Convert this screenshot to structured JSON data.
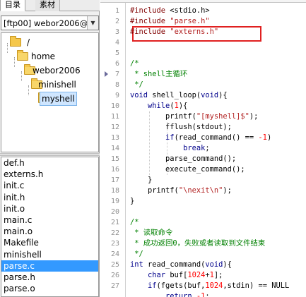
{
  "left_panel": {
    "tabs": [
      {
        "label": "目录"
      },
      {
        "label": "素材"
      }
    ],
    "project_select": {
      "value": "[ftp00] webor2006@"
    },
    "tree": [
      {
        "label": "/"
      },
      {
        "label": "home"
      },
      {
        "label": "webor2006"
      },
      {
        "label": "minishell"
      },
      {
        "label": "myshell"
      }
    ],
    "files": [
      {
        "label": "def.h"
      },
      {
        "label": "externs.h"
      },
      {
        "label": "init.c"
      },
      {
        "label": "init.h"
      },
      {
        "label": "init.o"
      },
      {
        "label": "main.c"
      },
      {
        "label": "main.o"
      },
      {
        "label": "Makefile"
      },
      {
        "label": "minishell"
      },
      {
        "label": "parse.c"
      },
      {
        "label": "parse.h"
      },
      {
        "label": "parse.o"
      }
    ]
  },
  "editor": {
    "line_numbers": [
      "1",
      "2",
      "3",
      "4",
      "5",
      "6",
      "7",
      "8",
      "9",
      "10",
      "11",
      "12",
      "13",
      "14",
      "15",
      "16",
      "17",
      "18",
      "19",
      "20",
      "21",
      "22",
      "23",
      "24",
      "25",
      "26",
      "27"
    ],
    "lines": [
      {
        "tokens": [
          {
            "t": "#include",
            "c": "pp"
          },
          {
            "t": " <stdio.h>",
            "c": "op"
          }
        ]
      },
      {
        "tokens": [
          {
            "t": "#include",
            "c": "pp"
          },
          {
            "t": " ",
            "c": "op"
          },
          {
            "t": "\"parse.h\"",
            "c": "str"
          }
        ]
      },
      {
        "tokens": [
          {
            "t": "#include",
            "c": "pp"
          },
          {
            "t": " ",
            "c": "op"
          },
          {
            "t": "\"externs.h\"",
            "c": "str"
          }
        ]
      },
      {
        "tokens": []
      },
      {
        "tokens": []
      },
      {
        "tokens": [
          {
            "t": "/*",
            "c": "cm"
          }
        ]
      },
      {
        "tokens": [
          {
            "t": " * shell主循环",
            "c": "cm"
          }
        ]
      },
      {
        "tokens": [
          {
            "t": " */",
            "c": "cm"
          }
        ]
      },
      {
        "tokens": [
          {
            "t": "void",
            "c": "kw"
          },
          {
            "t": " shell_loop(",
            "c": "op"
          },
          {
            "t": "void",
            "c": "kw"
          },
          {
            "t": "){",
            "c": "op"
          }
        ]
      },
      {
        "tokens": [
          {
            "t": "    ",
            "c": "op"
          },
          {
            "t": "while",
            "c": "kw"
          },
          {
            "t": "(",
            "c": "op"
          },
          {
            "t": "1",
            "c": "num"
          },
          {
            "t": "){",
            "c": "op"
          }
        ]
      },
      {
        "tokens": [
          {
            "t": "        printf(",
            "c": "op"
          },
          {
            "t": "\"[myshell]$\"",
            "c": "str"
          },
          {
            "t": ");",
            "c": "op"
          }
        ]
      },
      {
        "tokens": [
          {
            "t": "        fflush(stdout);",
            "c": "op"
          }
        ]
      },
      {
        "tokens": [
          {
            "t": "        ",
            "c": "op"
          },
          {
            "t": "if",
            "c": "kw"
          },
          {
            "t": "(read_command() == ",
            "c": "op"
          },
          {
            "t": "-1",
            "c": "num"
          },
          {
            "t": ")",
            "c": "op"
          }
        ]
      },
      {
        "tokens": [
          {
            "t": "            ",
            "c": "op"
          },
          {
            "t": "break",
            "c": "kw"
          },
          {
            "t": ";",
            "c": "op"
          }
        ]
      },
      {
        "tokens": [
          {
            "t": "        parse_command();",
            "c": "op"
          }
        ]
      },
      {
        "tokens": [
          {
            "t": "        execute_command();",
            "c": "op"
          }
        ]
      },
      {
        "tokens": [
          {
            "t": "    }",
            "c": "op"
          }
        ]
      },
      {
        "tokens": [
          {
            "t": "    printf(",
            "c": "op"
          },
          {
            "t": "\"\\nexit\\n\"",
            "c": "str"
          },
          {
            "t": ");",
            "c": "op"
          }
        ]
      },
      {
        "tokens": [
          {
            "t": "}",
            "c": "op"
          }
        ]
      },
      {
        "tokens": []
      },
      {
        "tokens": [
          {
            "t": "/*",
            "c": "cm"
          }
        ]
      },
      {
        "tokens": [
          {
            "t": " * 读取命令",
            "c": "cm"
          }
        ]
      },
      {
        "tokens": [
          {
            "t": " * 成功返回0，失败或者读取到文件结束",
            "c": "cm"
          }
        ]
      },
      {
        "tokens": [
          {
            "t": " */",
            "c": "cm"
          }
        ]
      },
      {
        "tokens": [
          {
            "t": "int",
            "c": "kw"
          },
          {
            "t": " read_command(",
            "c": "op"
          },
          {
            "t": "void",
            "c": "kw"
          },
          {
            "t": "){",
            "c": "op"
          }
        ]
      },
      {
        "tokens": [
          {
            "t": "    ",
            "c": "op"
          },
          {
            "t": "char",
            "c": "kw"
          },
          {
            "t": " buf[",
            "c": "op"
          },
          {
            "t": "1024",
            "c": "num"
          },
          {
            "t": "+",
            "c": "op"
          },
          {
            "t": "1",
            "c": "num"
          },
          {
            "t": "];",
            "c": "op"
          }
        ]
      },
      {
        "tokens": [
          {
            "t": "    ",
            "c": "op"
          },
          {
            "t": "if",
            "c": "kw"
          },
          {
            "t": "(fgets(buf,",
            "c": "op"
          },
          {
            "t": "1024",
            "c": "num"
          },
          {
            "t": ",stdin) == NULL",
            "c": "op"
          }
        ]
      },
      {
        "tokens": [
          {
            "t": "        ",
            "c": "op"
          },
          {
            "t": "return",
            "c": "kw"
          },
          {
            "t": " ",
            "c": "op"
          },
          {
            "t": "-1",
            "c": "num"
          },
          {
            "t": ";",
            "c": "op"
          }
        ]
      }
    ]
  }
}
